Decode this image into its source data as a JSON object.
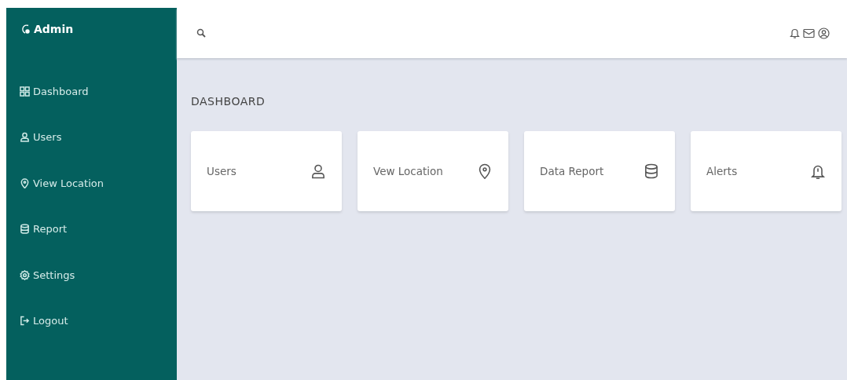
{
  "sidebar": {
    "brand": "Admin",
    "items": [
      {
        "label": "Dashboard"
      },
      {
        "label": "Users"
      },
      {
        "label": "View Location"
      },
      {
        "label": "Report"
      },
      {
        "label": "Settings"
      },
      {
        "label": "Logout"
      }
    ]
  },
  "page_title": "DASHBOARD",
  "cards": [
    {
      "label": "Users"
    },
    {
      "label": "Vew Location"
    },
    {
      "label": "Data Report"
    },
    {
      "label": "Alerts"
    }
  ]
}
